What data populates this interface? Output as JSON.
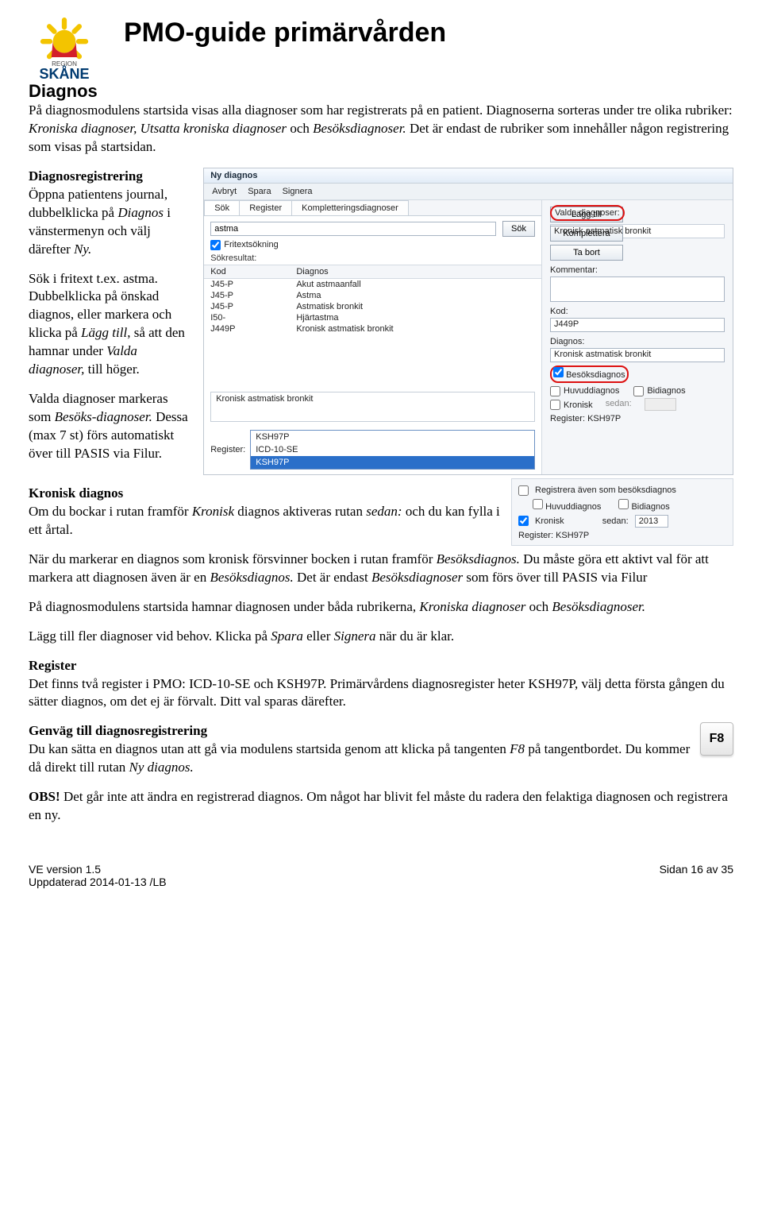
{
  "header": {
    "logo_region": "REGION",
    "logo_name": "SKÅNE",
    "title": "PMO-guide primärvården"
  },
  "section_heading": "Diagnos",
  "intro": {
    "p1a": "På diagnosmodulens startsida visas alla diagnoser som har registrerats på en patient. Diagnoserna sorteras under tre olika rubriker: ",
    "p1b": "Kroniska diagnoser, Utsatta kroniska diagnoser ",
    "p1c": "och ",
    "p1d": "Besöksdiagnoser. ",
    "p1e": "Det är endast de rubriker som innehåller någon registrering som visas på startsidan."
  },
  "left_col": {
    "h1": "Diagnosregistrering",
    "p1a": "Öppna patientens journal, dubbelklicka på ",
    "p1b": "Diagnos",
    "p1c": " i vänstermenyn och välj därefter ",
    "p1d": "Ny.",
    "p2a": "Sök i fritext t.ex. astma. Dubbelklicka på önskad diagnos, eller markera och klicka på ",
    "p2b": "Lägg till",
    "p2c": ", så att den hamnar under ",
    "p2d": "Valda diagnoser,",
    "p2e": " till höger.",
    "p3a": "Valda diagnoser markeras som ",
    "p3b": "Besöks-diagnoser.",
    "p3c": " Dessa (max 7 st) förs automatiskt över till PASIS via Filur."
  },
  "screenshot": {
    "title": "Ny diagnos",
    "toolbar": [
      "Avbryt",
      "Spara",
      "Signera"
    ],
    "tabs": [
      "Sök",
      "Register",
      "Kompletteringsdiagnoser"
    ],
    "search_value": "astma",
    "search_btn": "Sök",
    "freetext_label": "Fritextsökning",
    "result_label": "Sökresultat:",
    "columns": [
      "Kod",
      "Diagnos"
    ],
    "rows": [
      {
        "kod": "J45-P",
        "diagnos": "Akut astmaanfall"
      },
      {
        "kod": "J45-P",
        "diagnos": "Astma"
      },
      {
        "kod": "J45-P",
        "diagnos": "Astmatisk bronkit"
      },
      {
        "kod": "I50-",
        "diagnos": "Hjärtastma"
      },
      {
        "kod": "J449P",
        "diagnos": "Kronisk astmatisk bronkit"
      }
    ],
    "selected_list_item": "Kronisk astmatisk bronkit",
    "register_label": "Register:",
    "register_options": [
      "KSH97P",
      "ICD-10-SE",
      "KSH97P"
    ],
    "right": {
      "valda_label": "Valda diagnoser:",
      "valda_item": "Kronisk astmatisk bronkit",
      "btn_add": "Lägg till",
      "btn_complete": "Komplettera",
      "btn_remove": "Ta bort",
      "comment_label": "Kommentar:",
      "kod_label": "Kod:",
      "kod_value": "J449P",
      "diagnos_label": "Diagnos:",
      "diagnos_value": "Kronisk astmatisk bronkit",
      "besok_label": "Besöksdiagnos",
      "huvud_label": "Huvuddiagnos",
      "bi_label": "Bidiagnos",
      "kronisk_label": "Kronisk",
      "sedan_label": "sedan:",
      "register_text": "Register: KSH97P"
    }
  },
  "kronisk": {
    "heading": "Kronisk diagnos",
    "p_a": "Om du bockar i rutan framför ",
    "p_b": "Kronisk",
    "p_c": " diagnos aktiveras rutan ",
    "p_d": "sedan:",
    "p_e": " och du kan fylla i ett årtal."
  },
  "screenshot2": {
    "reg_also": "Registrera även som besöksdiagnos",
    "huvud": "Huvuddiagnos",
    "bi": "Bidiagnos",
    "kronisk": "Kronisk",
    "sedan": "sedan:",
    "year": "2013",
    "register": "Register: KSH97P"
  },
  "after_kronisk": {
    "p1a": "När du markerar en diagnos som kronisk försvinner bocken i rutan framför ",
    "p1b": "Besöksdiagnos.",
    "p1c": " Du måste göra ett aktivt val för att markera att diagnosen även är en ",
    "p1d": "Besöksdiagnos.",
    "p1e": " Det är endast ",
    "p1f": "Besöksdiagnoser",
    "p1g": " som förs över till PASIS via Filur",
    "p2a": "På diagnosmodulens startsida hamnar diagnosen under båda rubrikerna, ",
    "p2b": "Kroniska diagnoser",
    "p2c": " och ",
    "p2d": "Besöksdiagnoser.",
    "p3a": "Lägg till fler diagnoser vid behov. Klicka på ",
    "p3b": "Spara",
    "p3c": " eller ",
    "p3d": "Signera",
    "p3e": " när du är klar."
  },
  "register_section": {
    "heading": "Register",
    "p": "Det finns två register i PMO: ICD-10-SE och KSH97P. Primärvårdens diagnosregister heter KSH97P, välj detta första gången du sätter diagnos, om det ej är förvalt. Ditt val sparas därefter."
  },
  "shortcut": {
    "heading": "Genväg till diagnosregistrering",
    "p_a": "Du kan sätta en diagnos utan att gå via modulens startsida genom att klicka på tangenten ",
    "p_b": "F8",
    "p_c": " på tangentbordet. Du kommer då direkt till rutan ",
    "p_d": "Ny diagnos.",
    "key": "F8"
  },
  "obs": {
    "b": "OBS!",
    "t": " Det går inte att ändra en registrerad diagnos. Om något har blivit fel måste du radera den felaktiga diagnosen och registrera en ny."
  },
  "footer": {
    "left1": "VE version 1.5",
    "left2": "Uppdaterad 2014-01-13 /LB",
    "right": "Sidan 16 av 35"
  }
}
